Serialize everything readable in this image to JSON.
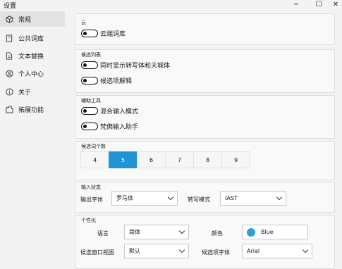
{
  "window": {
    "title": "设置",
    "minimize": "−",
    "maximize": "☐",
    "close": "✕"
  },
  "sidebar": {
    "items": [
      {
        "label": "常规",
        "icon": "cube-icon"
      },
      {
        "label": "公共词库",
        "icon": "book-icon"
      },
      {
        "label": "文本替换",
        "icon": "document-icon"
      },
      {
        "label": "个人中心",
        "icon": "person-icon"
      },
      {
        "label": "关于",
        "icon": "info-icon"
      },
      {
        "label": "拓展功能",
        "icon": "extension-icon"
      }
    ]
  },
  "cloud": {
    "title": "云",
    "toggle_label": "云端词库"
  },
  "candidates_list": {
    "title": "候选列表",
    "toggle1": "同时显示转写体和天城体",
    "toggle2": "候选项解释"
  },
  "tools": {
    "title": "辅助工具",
    "toggle1": "混合输入模式",
    "toggle2": "梵佛输入助手"
  },
  "count": {
    "title": "候选词个数",
    "options": [
      "4",
      "5",
      "6",
      "7",
      "8",
      "9"
    ],
    "selected": "5"
  },
  "input_state": {
    "title": "输入状态",
    "font_label": "输出字体",
    "font_value": "罗马体",
    "translit_label": "转写模式",
    "translit_value": "IAST"
  },
  "personalize": {
    "title": "个性化",
    "lang_label": "语言",
    "lang_value": "简体",
    "color_label": "颜色",
    "color_value": "Blue",
    "color_hex": "#2a9fd8",
    "view_label": "候选窗口视图",
    "view_value": "默认",
    "cand_font_label": "候选项字体",
    "cand_font_value": "Arial"
  }
}
